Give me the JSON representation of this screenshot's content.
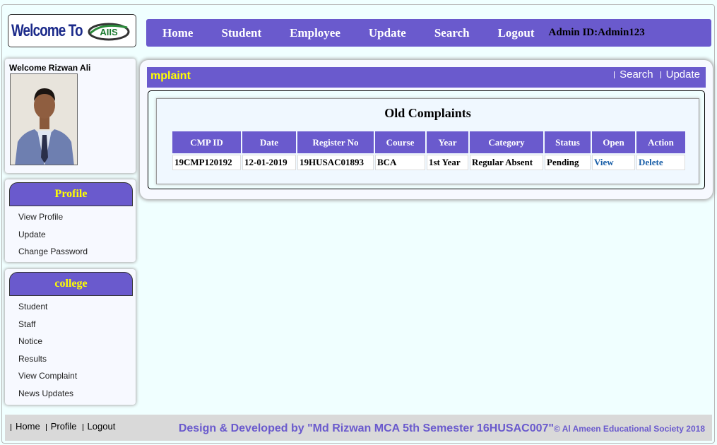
{
  "header": {
    "logo_text": "Welcome To",
    "logo_mark_text": "AIIS",
    "nav": [
      "Home",
      "Student",
      "Employee",
      "Update",
      "Search",
      "Logout"
    ],
    "admin_id": "Admin ID:Admin123"
  },
  "sidebar": {
    "welcome": "Welcome Rizwan Ali",
    "profile": {
      "title": "Profile",
      "items": [
        "View Profile",
        "Update",
        "Change Password"
      ]
    },
    "college": {
      "title": "college",
      "items": [
        "Student",
        "Staff",
        "Notice",
        "Results",
        "View Complaint",
        "News Updates"
      ]
    }
  },
  "main": {
    "marquee": "mplaint",
    "links": [
      "Search",
      "Update"
    ],
    "table_title": "Old Complaints",
    "columns": [
      "CMP ID",
      "Date",
      "Register No",
      "Course",
      "Year",
      "Category",
      "Status",
      "Open",
      "Action"
    ],
    "rows": [
      [
        "19CMP120192",
        "12-01-2019",
        "19HUSAC01893",
        "BCA",
        "1st Year",
        "Regular Absent",
        "Pending",
        "View",
        "Delete"
      ]
    ]
  },
  "footer": {
    "links": [
      "Home",
      "Profile",
      "Logout"
    ],
    "credit": "Design & Developed by \"Md Rizwan MCA 5th Semester 16HUSAC007\"",
    "copyright": "© Al Ameen Educational Society 2018"
  },
  "colors": {
    "accent": "#6a5acd",
    "background": "#f0ffff",
    "highlight": "#ffff00",
    "link": "#1a5fa8"
  },
  "icons": {
    "logo": "aiis-logo-icon",
    "photo": "user-photo"
  }
}
